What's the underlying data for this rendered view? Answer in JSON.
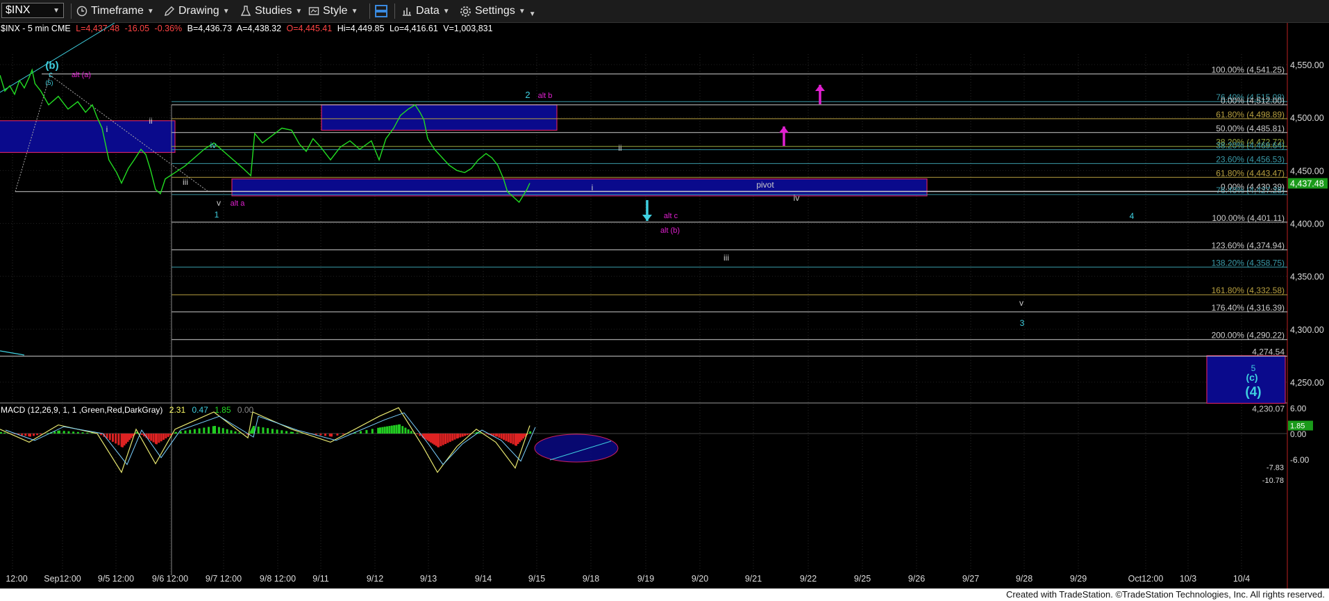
{
  "toolbar": {
    "symbol": "$INX",
    "timeframe": "Timeframe",
    "drawing": "Drawing",
    "studies": "Studies",
    "style": "Style",
    "data": "Data",
    "settings": "Settings"
  },
  "header": {
    "symbol": "$INX - 5 min  CME",
    "last": "L=4,437.48",
    "change": "-16.05",
    "pct": "-0.36%",
    "bid": "B=4,436.73",
    "ask": "A=4,438.32",
    "open": "O=4,445.41",
    "high": "Hi=4,449.85",
    "low": "Lo=4,416.61",
    "volume": "V=1,003,831"
  },
  "macd": {
    "label": "MACD (12,26,9, 1, 1 ,Green,Red,DarkGray)",
    "v1": "2.31",
    "v2": "0.47",
    "v3": "1.85",
    "v4": "0.00"
  },
  "footer": "Created with TradeStation. ©TradeStation Technologies, Inc. All rights reserved.",
  "colors": {
    "price": "#22dd22",
    "cyan": "#3fd0e0",
    "magenta": "#e020d0",
    "box_fill": "#0a0a8c",
    "box_border": "#d02060"
  },
  "chart_data": {
    "type": "line",
    "symbol": "$INX",
    "interval": "5 min",
    "ylim": [
      4225,
      4580
    ],
    "y_ticks": [
      "4,550.00",
      "4,500.00",
      "4,450.00",
      "4,400.00",
      "4,350.00",
      "4,300.00",
      "4,250.00"
    ],
    "y_tick_values": [
      4550,
      4500,
      4450,
      4400,
      4350,
      4300,
      4250
    ],
    "x_ticks": [
      "12:00",
      "Sep12:00",
      "9/5 12:00",
      "9/6 12:00",
      "9/7 12:00",
      "9/8 12:00",
      "9/11",
      "9/12",
      "9/13",
      "9/14",
      "9/15",
      "9/18",
      "9/19",
      "9/20",
      "9/21",
      "9/22",
      "9/25",
      "9/26",
      "9/27",
      "9/28",
      "9/29",
      "Oct12:00",
      "10/3",
      "10/4"
    ],
    "last_price": "4,437.48",
    "price_series": [
      [
        0,
        4540
      ],
      [
        0.05,
        4525
      ],
      [
        0.1,
        4530
      ],
      [
        0.15,
        4522
      ],
      [
        0.2,
        4535
      ],
      [
        0.25,
        4528
      ],
      [
        0.3,
        4538
      ],
      [
        0.33,
        4545
      ],
      [
        0.36,
        4532
      ],
      [
        0.42,
        4525
      ],
      [
        0.5,
        4512
      ],
      [
        0.6,
        4520
      ],
      [
        0.7,
        4508
      ],
      [
        0.8,
        4515
      ],
      [
        0.88,
        4505
      ],
      [
        0.95,
        4512
      ],
      [
        1.0,
        4500
      ],
      [
        1.05,
        4490
      ],
      [
        1.12,
        4460
      ],
      [
        1.2,
        4448
      ],
      [
        1.25,
        4438
      ],
      [
        1.32,
        4452
      ],
      [
        1.38,
        4460
      ],
      [
        1.45,
        4470
      ],
      [
        1.5,
        4465
      ],
      [
        1.55,
        4450
      ],
      [
        1.6,
        4432
      ],
      [
        1.65,
        4428
      ],
      [
        1.7,
        4442
      ],
      [
        1.8,
        4448
      ],
      [
        1.9,
        4454
      ],
      [
        2.0,
        4462
      ],
      [
        2.1,
        4470
      ],
      [
        2.2,
        4476
      ],
      [
        2.3,
        4468
      ],
      [
        2.4,
        4460
      ],
      [
        2.5,
        4452
      ],
      [
        2.58,
        4445
      ],
      [
        2.62,
        4485
      ],
      [
        2.7,
        4476
      ],
      [
        2.8,
        4483
      ],
      [
        2.9,
        4490
      ],
      [
        3.0,
        4488
      ],
      [
        3.08,
        4475
      ],
      [
        3.15,
        4468
      ],
      [
        3.22,
        4480
      ],
      [
        3.3,
        4472
      ],
      [
        3.4,
        4460
      ],
      [
        3.5,
        4472
      ],
      [
        3.6,
        4478
      ],
      [
        3.7,
        4470
      ],
      [
        3.82,
        4478
      ],
      [
        3.9,
        4460
      ],
      [
        3.97,
        4480
      ],
      [
        4.05,
        4490
      ],
      [
        4.12,
        4502
      ],
      [
        4.2,
        4508
      ],
      [
        4.27,
        4512
      ],
      [
        4.32,
        4505
      ],
      [
        4.36,
        4498
      ],
      [
        4.4,
        4480
      ],
      [
        4.47,
        4470
      ],
      [
        4.55,
        4462
      ],
      [
        4.62,
        4455
      ],
      [
        4.7,
        4450
      ],
      [
        4.78,
        4448
      ],
      [
        4.85,
        4452
      ],
      [
        4.92,
        4460
      ],
      [
        5.0,
        4466
      ],
      [
        5.06,
        4462
      ],
      [
        5.12,
        4455
      ],
      [
        5.18,
        4442
      ],
      [
        5.22,
        4430
      ],
      [
        5.28,
        4425
      ],
      [
        5.34,
        4420
      ],
      [
        5.38,
        4426
      ],
      [
        5.42,
        4432
      ],
      [
        5.45,
        4438
      ]
    ],
    "macd_series": [
      [
        0,
        1
      ],
      [
        0.3,
        -2
      ],
      [
        0.6,
        2
      ],
      [
        1.0,
        0
      ],
      [
        1.25,
        -9
      ],
      [
        1.4,
        1
      ],
      [
        1.6,
        -7
      ],
      [
        1.8,
        1
      ],
      [
        2.2,
        5
      ],
      [
        2.55,
        -1
      ],
      [
        2.6,
        5
      ],
      [
        3.0,
        1
      ],
      [
        3.4,
        -2
      ],
      [
        3.9,
        4
      ],
      [
        4.1,
        6
      ],
      [
        4.35,
        -3
      ],
      [
        4.5,
        -9
      ],
      [
        4.7,
        -3
      ],
      [
        4.9,
        1
      ],
      [
        5.1,
        -2
      ],
      [
        5.3,
        -8
      ],
      [
        5.45,
        1.85
      ]
    ],
    "macd_ylim": [
      -11,
      8
    ],
    "macd_ticks": [
      "6.00",
      "0.00",
      "-6.00"
    ],
    "macd_tick_values": [
      6,
      0,
      -6
    ],
    "macd_right_labels": [
      "-7.83",
      "-10.78"
    ],
    "macd_right_values": [
      -7.83,
      -10.78
    ],
    "fib_levels_upper": [
      {
        "label": "100.00% (4,541.25)",
        "value": 4541.25,
        "color": "#cccccc"
      },
      {
        "label": "76.40% (4,515.08)",
        "value": 4515.08,
        "color": "#3a9aa8"
      },
      {
        "label": "0.00% (4,512.00)",
        "value": 4512.0,
        "color": "#cccccc"
      },
      {
        "label": "61.80% (4,498.89)",
        "value": 4498.89,
        "color": "#b8a040"
      },
      {
        "label": "50.00% (4,485.81)",
        "value": 4485.81,
        "color": "#cccccc"
      },
      {
        "label": "38.20% (4,472.72)",
        "value": 4472.72,
        "color": "#9aaa40"
      },
      {
        "label": "38.20% (4,469.64)",
        "value": 4469.64,
        "color": "#3a9aa8"
      },
      {
        "label": "23.60% (4,456.53)",
        "value": 4456.53,
        "color": "#3a9aa8"
      },
      {
        "label": "61.80% (4,443.47)",
        "value": 4443.47,
        "color": "#b8a040"
      },
      {
        "label": "0.00% (4,430.39)",
        "value": 4430.39,
        "color": "#cccccc"
      },
      {
        "label": "76.40% (4,427.28)",
        "value": 4427.28,
        "color": "#3a9aa8"
      }
    ],
    "fib_levels_lower": [
      {
        "label": "100.00% (4,401.11)",
        "value": 4401.11,
        "color": "#cccccc"
      },
      {
        "label": "123.60% (4,374.94)",
        "value": 4374.94,
        "color": "#cccccc"
      },
      {
        "label": "138.20% (4,358.75)",
        "value": 4358.75,
        "color": "#3a9aa8"
      },
      {
        "label": "161.80% (4,332.58)",
        "value": 4332.58,
        "color": "#b8a040"
      },
      {
        "label": "176.40% (4,316.39)",
        "value": 4316.39,
        "color": "#cccccc"
      },
      {
        "label": "200.00% (4,290.22)",
        "value": 4290.22,
        "color": "#cccccc"
      }
    ],
    "level_labels": [
      {
        "label": "4,274.54",
        "value": 4274.54
      },
      {
        "label": "4,230.07",
        "value": 4230.07
      }
    ],
    "pivot_label": "pivot",
    "wave_labels": {
      "b_paren": "(b)",
      "c": "c",
      "five_paren": "(5)",
      "alt_a_paren": "alt (a)",
      "ii": "ii",
      "i": "i",
      "iii": "iii",
      "iv": "iv",
      "v": "v",
      "one": "1",
      "alt_a": "alt a",
      "two": "2",
      "alt_b": "alt b",
      "ii2": "ii",
      "i2": "i",
      "alt_c": "alt c",
      "alt_b_paren": "alt (b)",
      "iv2": "iv",
      "iii2": "iii",
      "four": "4",
      "v2": "v",
      "three": "3",
      "five": "5",
      "c_paren": "(c)",
      "four_paren": "(4)"
    }
  }
}
